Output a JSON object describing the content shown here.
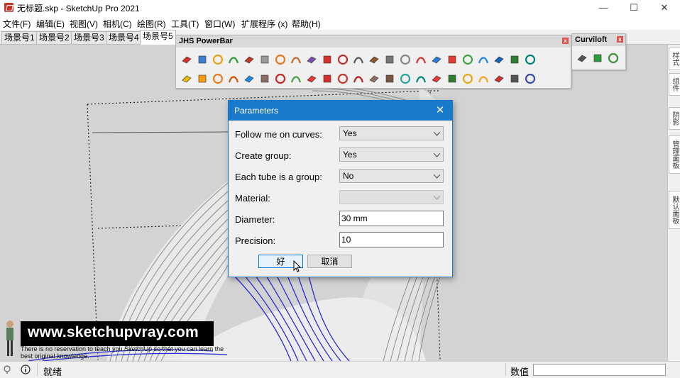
{
  "window": {
    "title": "无标题.skp - SketchUp Pro 2021",
    "controls": {
      "minimize": "—",
      "maximize": "☐",
      "close": "✕"
    }
  },
  "menu": {
    "items": [
      "文件(F)",
      "编辑(E)",
      "视图(V)",
      "相机(C)",
      "绘图(R)",
      "工具(T)",
      "窗口(W)",
      "扩展程序 (x)",
      "帮助(H)"
    ]
  },
  "scene_tabs": {
    "items": [
      "场景号1",
      "场景号2",
      "场景号3",
      "场景号4",
      "场景号5"
    ],
    "active_index": 4
  },
  "toolbars": {
    "powerbar": {
      "title": "JHS PowerBar",
      "close": "x",
      "row1_count": 23,
      "row2_count": 23
    },
    "curviloft": {
      "title": "Curviloft",
      "close": "x",
      "tool_count": 3
    }
  },
  "dialog": {
    "title": "Parameters",
    "close": "✕",
    "fields": [
      {
        "label": "Follow me on curves:",
        "kind": "select",
        "value": "Yes"
      },
      {
        "label": "Create group:",
        "kind": "select",
        "value": "Yes"
      },
      {
        "label": "Each tube is a group:",
        "kind": "select",
        "value": "No"
      },
      {
        "label": "Material:",
        "kind": "select",
        "value": "",
        "disabled": true
      },
      {
        "label": "Diameter:",
        "kind": "input",
        "value": "30 mm"
      },
      {
        "label": "Precision:",
        "kind": "input",
        "value": "10"
      }
    ],
    "ok_label": "好",
    "cancel_label": "取消"
  },
  "right_tray": {
    "tabs": [
      "样式",
      "组件",
      "阴影",
      "管理面板",
      "默认面板"
    ]
  },
  "statusbar": {
    "status_text": "就绪",
    "measurements_label": "数值",
    "measurements_value": ""
  },
  "watermark": {
    "url": "www.sketchupvray.com",
    "tagline": "There is no reservation to teach you SketchUp so that you can learn the best original knowledge."
  },
  "colors": {
    "dialog_accent": "#1979ca",
    "viewport_bg": "#d3d3d3",
    "curve_blue": "#2a2ad6"
  }
}
